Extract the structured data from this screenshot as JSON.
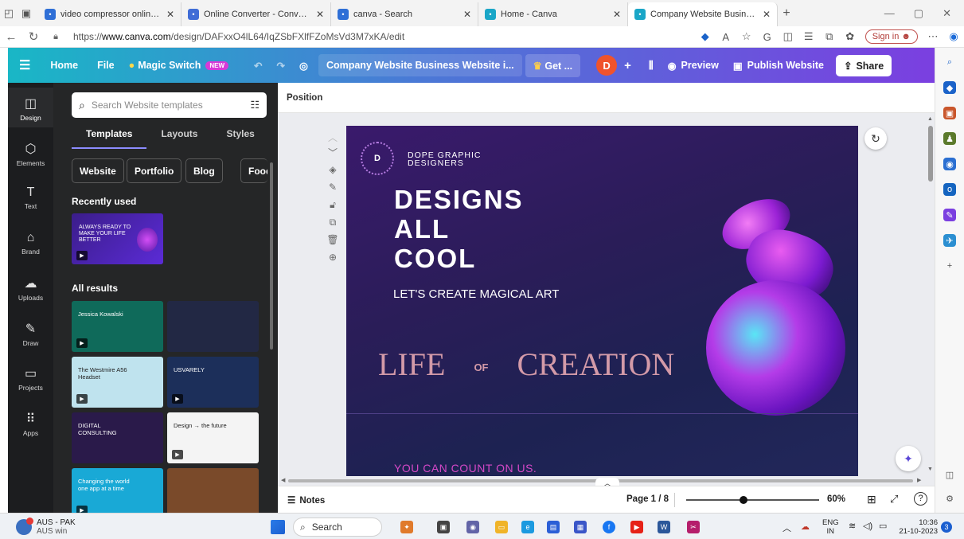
{
  "browser": {
    "tabs": [
      {
        "label": "video compressor online free - S",
        "icon": "search-icon",
        "color": "#2f6fd6"
      },
      {
        "label": "Online Converter - Convert Imag",
        "icon": "converter-icon",
        "color": "#3f6cd6"
      },
      {
        "label": "canva - Search",
        "icon": "search-icon",
        "color": "#2f6fd6"
      },
      {
        "label": "Home - Canva",
        "icon": "canva-icon",
        "color": "#1aa6c7"
      },
      {
        "label": "Company Website Business Web",
        "icon": "canva-icon",
        "color": "#1aa6c7",
        "active": true
      }
    ],
    "new_tab": "+",
    "url_prefix": "https://",
    "url_host": "www.canva.com",
    "url_path": "/design/DAFxxO4lL64/IqZSbFXlfFZoMsVd3M7xKA/edit",
    "sign_in": "Sign in"
  },
  "canva": {
    "menu_home": "Home",
    "menu_file": "File",
    "magic_switch": "Magic Switch",
    "new_badge": "NEW",
    "doc_name": "Company Website Business Website i...",
    "get_label": "Get ...",
    "avatar_letter": "D",
    "preview": "Preview",
    "publish": "Publish Website",
    "share": "Share"
  },
  "rail": [
    {
      "label": "Design",
      "icon": "design-icon",
      "glyph": "◫",
      "active": true
    },
    {
      "label": "Elements",
      "icon": "elements-icon",
      "glyph": "⬡"
    },
    {
      "label": "Text",
      "icon": "text-icon",
      "glyph": "T"
    },
    {
      "label": "Brand",
      "icon": "brand-icon",
      "glyph": "⌂"
    },
    {
      "label": "Uploads",
      "icon": "uploads-icon",
      "glyph": "☁"
    },
    {
      "label": "Draw",
      "icon": "draw-icon",
      "glyph": "✎"
    },
    {
      "label": "Projects",
      "icon": "folder-icon",
      "glyph": "▭"
    },
    {
      "label": "Apps",
      "icon": "apps-icon",
      "glyph": "⠿"
    }
  ],
  "panel": {
    "search_placeholder": "Search Website templates",
    "tabs": [
      "Templates",
      "Layouts",
      "Styles"
    ],
    "chips": [
      "Website",
      "Portfolio",
      "Blog",
      "Food"
    ],
    "recent_heading": "Recently used",
    "recent_thumb_text": "ALWAYS READY TO MAKE YOUR LIFE BETTER",
    "results_heading": "All results",
    "thumbs": [
      {
        "text": "Jessica Kowalski",
        "bg": "#0f6a5a"
      },
      {
        "text": "",
        "bg": "#222844"
      },
      {
        "text": "The Westmire A56 Headset",
        "bg": "#bfe3ee"
      },
      {
        "text": "USVARELY",
        "bg": "#1c2f5a"
      },
      {
        "text": "DIGITAL CONSULTING",
        "bg": "#2a1a4a"
      },
      {
        "text": "Design → the future",
        "bg": "#f4f4f4"
      },
      {
        "text": "Changing the world one app at a time",
        "bg": "#19a9d6"
      },
      {
        "text": "",
        "bg": "#7a4a2a"
      }
    ]
  },
  "editor": {
    "position_label": "Position",
    "brand_line1": "DOPE GRAPHIC",
    "brand_line2": "DESIGNERS",
    "logo_letter": "D",
    "headline_1": "DESIGNS",
    "headline_2": "ALL",
    "headline_3": "COOL",
    "tagline": "LET'S CREATE MAGICAL ART",
    "life": "LIFE",
    "of": "OF",
    "creation": "CREATION",
    "footer_line": "YOU CAN COUNT ON US.",
    "notes": "Notes",
    "page": "Page 1 / 8",
    "zoom": "60%",
    "zoom_level": 0.6
  },
  "taskbar": {
    "weather_1": "AUS - PAK",
    "weather_2": "AUS win",
    "search": "Search",
    "lang_1": "ENG",
    "lang_2": "IN",
    "time": "10:36",
    "date": "21-10-2023",
    "notif_count": "3"
  }
}
